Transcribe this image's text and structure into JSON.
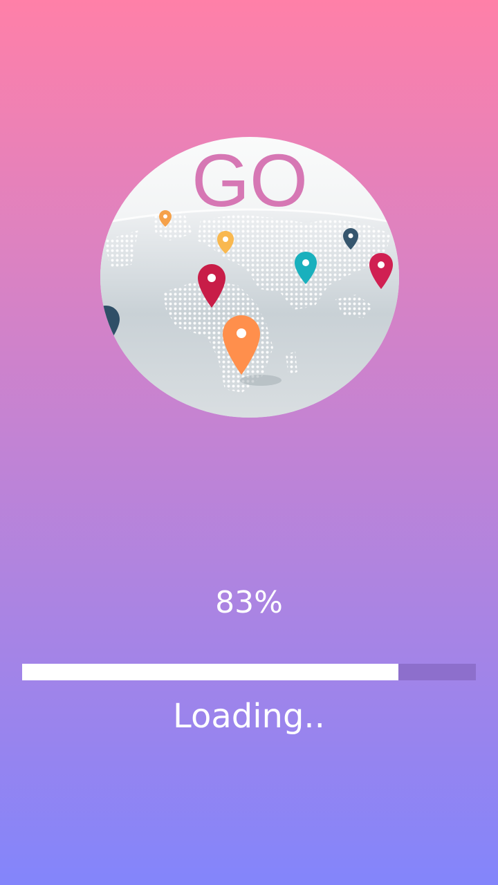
{
  "logo": {
    "text": "GO",
    "text_color": "#d677b4",
    "icon": "globe-with-map-pins"
  },
  "progress": {
    "percent_label": "83%",
    "value": 0.83,
    "fill_color": "#ffffff",
    "track_color": "#8d6fcc"
  },
  "status": {
    "label": "Loading.."
  },
  "background": {
    "top_color": "#ff80a8",
    "bottom_color": "#8385fb"
  }
}
